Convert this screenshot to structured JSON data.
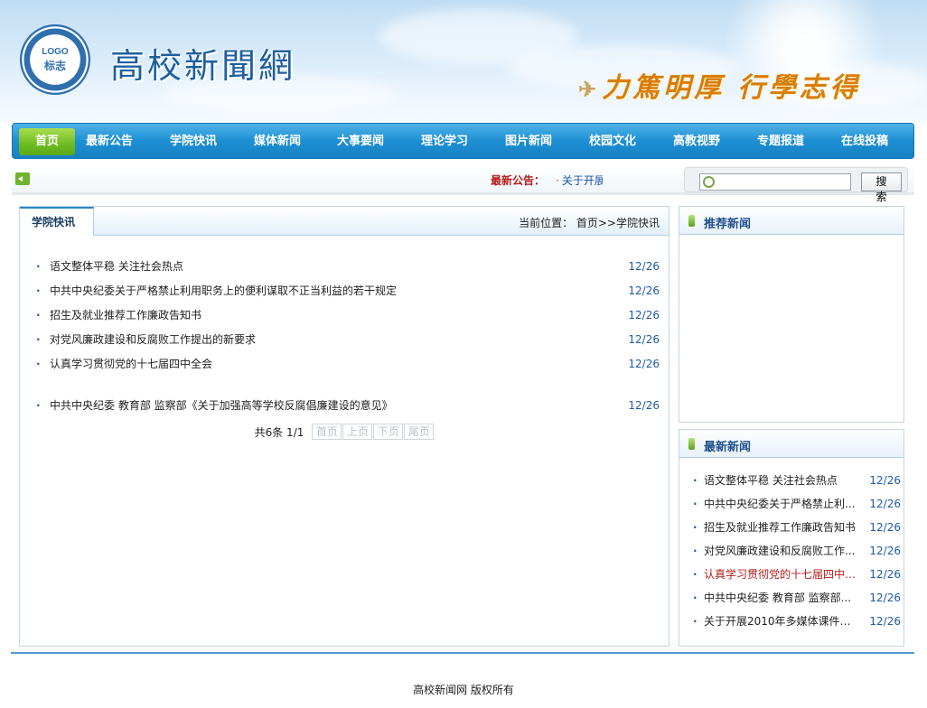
{
  "header": {
    "logo_text": "LOGO",
    "logo_cn": "标志",
    "site_title": "高校新聞網",
    "slogan": "力篤明厚  行學志得"
  },
  "nav": {
    "items": [
      {
        "label": "首页",
        "active": true
      },
      {
        "label": "最新公告"
      },
      {
        "label": "学院快讯"
      },
      {
        "label": "媒体新闻"
      },
      {
        "label": "大事要闻"
      },
      {
        "label": "理论学习"
      },
      {
        "label": "图片新闻"
      },
      {
        "label": "校园文化"
      },
      {
        "label": "高教视野"
      },
      {
        "label": "专题报道"
      },
      {
        "label": "在线投稿"
      }
    ]
  },
  "notice": {
    "label": "最新公告：",
    "bullet": "·",
    "text": "关于开展"
  },
  "search": {
    "button_label": "搜 索",
    "value": ""
  },
  "main": {
    "tab_title": "学院快讯",
    "breadcrumb": "当前位置：  首页>>学院快讯",
    "bullet": "·",
    "articles": [
      {
        "title": "语文整体平稳 关注社会热点",
        "date": "12/26"
      },
      {
        "title": "中共中央纪委关于严格禁止利用职务上的便利谋取不正当利益的若干规定",
        "date": "12/26"
      },
      {
        "title": "招生及就业推荐工作廉政告知书",
        "date": "12/26"
      },
      {
        "title": "对党风廉政建设和反腐败工作提出的新要求",
        "date": "12/26"
      },
      {
        "title": "认真学习贯彻党的十七届四中全会",
        "date": "12/26"
      },
      {
        "title": "中共中央纪委 教育部 监察部《关于加强高等学校反腐倡廉建设的意见》",
        "date": "12/26"
      }
    ],
    "pager": {
      "info": "共6条   1/1",
      "first": "首页",
      "prev": "上页",
      "next": "下页",
      "last": "尾页"
    }
  },
  "recommended": {
    "title": "推荐新闻"
  },
  "latest": {
    "title": "最新新闻",
    "bullet": "·",
    "items": [
      {
        "title": "语文整体平稳 关注社会热点",
        "date": "12/26"
      },
      {
        "title": "中共中央纪委关于严格禁止利...",
        "date": "12/26"
      },
      {
        "title": "招生及就业推荐工作廉政告知书",
        "date": "12/26"
      },
      {
        "title": "对党风廉政建设和反腐败工作...",
        "date": "12/26"
      },
      {
        "title": "认真学习贯彻党的十七届四中全会",
        "date": "12/26",
        "highlight": true
      },
      {
        "title": "中共中央纪委 教育部 监察部...",
        "date": "12/26"
      },
      {
        "title": "关于开展2010年多媒体课件制...",
        "date": "12/26"
      }
    ]
  },
  "footer": {
    "copyright": "高校新闻网  版权所有"
  }
}
